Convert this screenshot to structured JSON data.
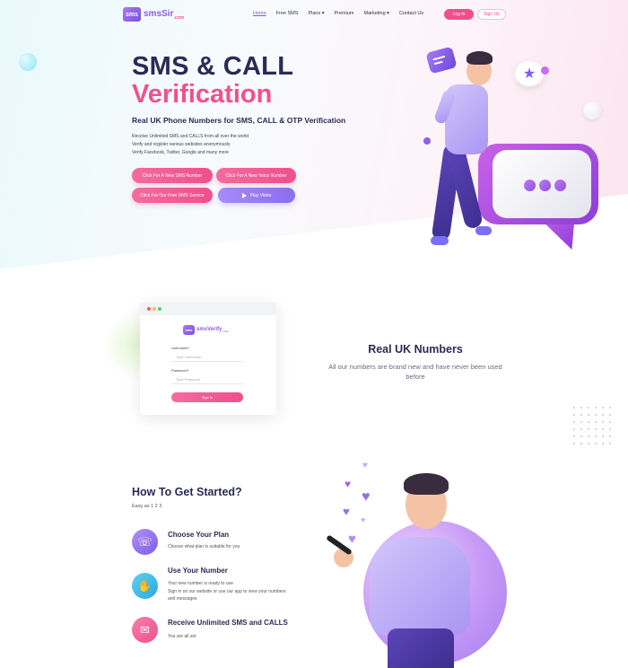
{
  "nav": {
    "logo_box": "sms",
    "logo_text": "smsSir",
    "logo_suffix": ".com",
    "links": [
      "Home",
      "Free SMS",
      "Plans ▾",
      "Premium",
      "Marketing ▾",
      "Contact Us"
    ],
    "login": "Log In",
    "signup": "Sign Up"
  },
  "hero": {
    "title_line1": "SMS & CALL",
    "title_line2": "Verification",
    "subtitle": "Real UK Phone Numbers for SMS, CALL & OTP Verification",
    "lines": [
      "Receive Unlimited SMS and CALLS from all over the world",
      "Verify and register various websites anonymously",
      "Verify Facebook, Twitter, Google and many more"
    ],
    "buttons": {
      "new_sms": "Click For A New SMS Number",
      "new_voice": "Click For A New Voice Number",
      "free_sms": "Click For Our Free SMS Service",
      "play_video": "Play Video"
    }
  },
  "login_card": {
    "logo_text": "smsVerify",
    "logo_suffix": ".com",
    "username_label": "Username*",
    "username_placeholder": "Type Username",
    "password_label": "Password*",
    "password_placeholder": "Type Password",
    "signin": "Sign In"
  },
  "features": {
    "title": "Real UK Numbers",
    "text": "All our numbers are brand new and have never been used before"
  },
  "started": {
    "title": "How To Get Started?",
    "subtitle": "Easy as 1 2 3",
    "steps": [
      {
        "title": "Choose Your Plan",
        "desc": "Choose what plan is suitable for you"
      },
      {
        "title": "Use Your Number",
        "desc": "Your new number is ready to use\nSign in on our website or use our app to view your numbers\nand messages"
      },
      {
        "title": "Receive Unlimited SMS and CALLS",
        "desc": "You are all set"
      }
    ]
  },
  "colors": {
    "brand_pink": "#f2508f",
    "brand_purple": "#8a6df2",
    "heading": "#2a2b55"
  }
}
